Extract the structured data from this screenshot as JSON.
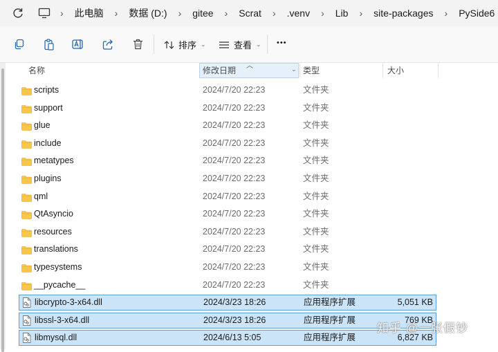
{
  "breadcrumb": [
    "此电脑",
    "数据 (D:)",
    "gitee",
    "Scrat",
    ".venv",
    "Lib",
    "site-packages",
    "PySide6"
  ],
  "toolbar": {
    "sort_label": "排序",
    "view_label": "查看",
    "more_label": "•••"
  },
  "columns": {
    "name": "名称",
    "modified": "修改日期",
    "type": "类型",
    "size": "大小"
  },
  "files": [
    {
      "name": "scripts",
      "modified": "2024/7/20 22:23",
      "type": "文件夹",
      "size": "",
      "kind": "folder",
      "selected": false
    },
    {
      "name": "support",
      "modified": "2024/7/20 22:23",
      "type": "文件夹",
      "size": "",
      "kind": "folder",
      "selected": false
    },
    {
      "name": "glue",
      "modified": "2024/7/20 22:23",
      "type": "文件夹",
      "size": "",
      "kind": "folder",
      "selected": false
    },
    {
      "name": "include",
      "modified": "2024/7/20 22:23",
      "type": "文件夹",
      "size": "",
      "kind": "folder",
      "selected": false
    },
    {
      "name": "metatypes",
      "modified": "2024/7/20 22:23",
      "type": "文件夹",
      "size": "",
      "kind": "folder",
      "selected": false
    },
    {
      "name": "plugins",
      "modified": "2024/7/20 22:23",
      "type": "文件夹",
      "size": "",
      "kind": "folder",
      "selected": false
    },
    {
      "name": "qml",
      "modified": "2024/7/20 22:23",
      "type": "文件夹",
      "size": "",
      "kind": "folder",
      "selected": false
    },
    {
      "name": "QtAsyncio",
      "modified": "2024/7/20 22:23",
      "type": "文件夹",
      "size": "",
      "kind": "folder",
      "selected": false
    },
    {
      "name": "resources",
      "modified": "2024/7/20 22:23",
      "type": "文件夹",
      "size": "",
      "kind": "folder",
      "selected": false
    },
    {
      "name": "translations",
      "modified": "2024/7/20 22:23",
      "type": "文件夹",
      "size": "",
      "kind": "folder",
      "selected": false
    },
    {
      "name": "typesystems",
      "modified": "2024/7/20 22:23",
      "type": "文件夹",
      "size": "",
      "kind": "folder",
      "selected": false
    },
    {
      "name": "__pycache__",
      "modified": "2024/7/20 22:23",
      "type": "文件夹",
      "size": "",
      "kind": "folder",
      "selected": false
    },
    {
      "name": "libcrypto-3-x64.dll",
      "modified": "2024/3/23 18:26",
      "type": "应用程序扩展",
      "size": "5,051 KB",
      "kind": "dll",
      "selected": true
    },
    {
      "name": "libssl-3-x64.dll",
      "modified": "2024/3/23 18:26",
      "type": "应用程序扩展",
      "size": "769 KB",
      "kind": "dll",
      "selected": true
    },
    {
      "name": "libmysql.dll",
      "modified": "2024/6/13 5:05",
      "type": "应用程序扩展",
      "size": "6,827 KB",
      "kind": "dll",
      "selected": true
    }
  ],
  "watermark": "知乎 @一张假钞",
  "colors": {
    "selection_bg": "#cce4f7",
    "selection_border": "#5b9fd6",
    "folder_yellow": "#f8c74a",
    "sort_column_bg": "#e6f0fb"
  }
}
